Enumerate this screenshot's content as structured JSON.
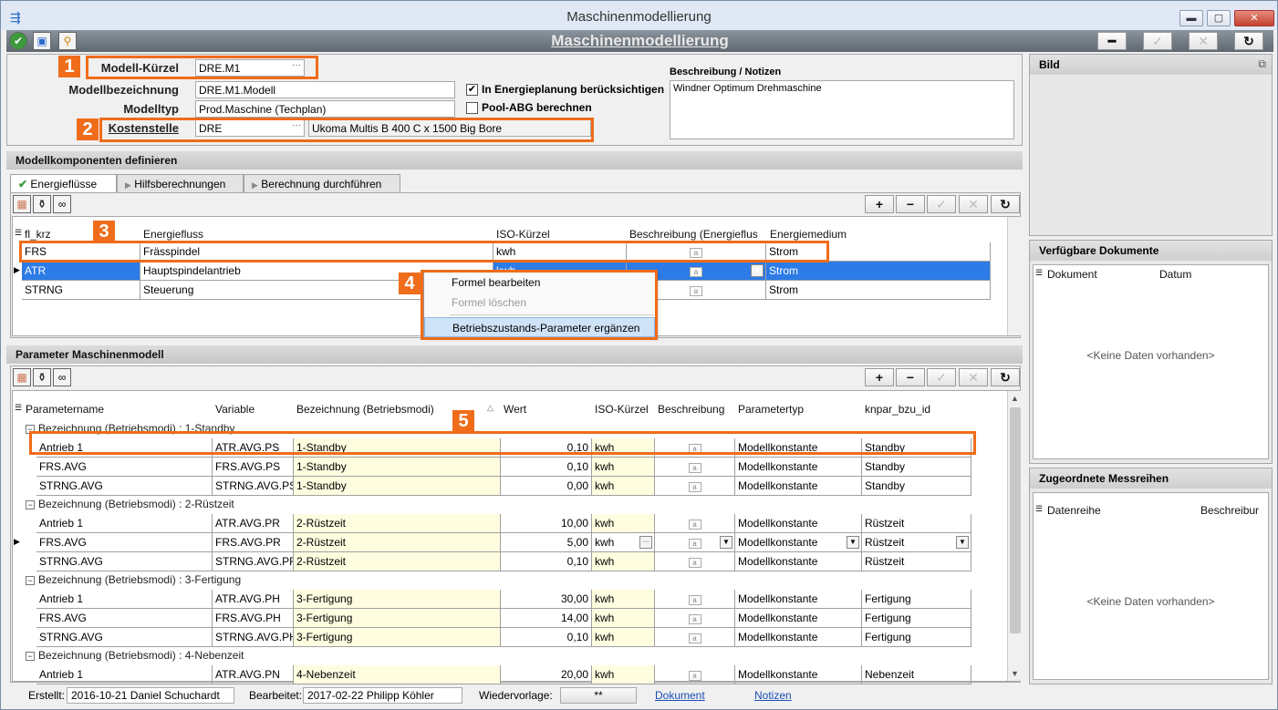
{
  "window": {
    "title": "Maschinenmodellierung"
  },
  "header": {
    "title": "Maschinenmodellierung"
  },
  "form": {
    "modell_kuerzel_label": "Modell-Kürzel",
    "modell_kuerzel": "DRE.M1",
    "modellbezeichnung_label": "Modellbezeichnung",
    "modellbezeichnung": "DRE.M1.Modell",
    "modelltyp_label": "Modelltyp",
    "modelltyp": "Prod.Maschine (Techplan)",
    "kostenstelle_label": "Kostenstelle",
    "kostenstelle": "DRE",
    "kostenstelle_name": "Ukoma Multis B 400 C x 1500 Big Bore",
    "energieplanung_label": "In Energieplanung berücksichtigen",
    "energieplanung_checked": true,
    "pool_label": "Pool-ABG berechnen",
    "pool_checked": false,
    "notes_label": "Beschreibung / Notizen",
    "notes": "Windner Optimum Drehmaschine"
  },
  "badges": [
    "1",
    "2",
    "3",
    "4",
    "5"
  ],
  "komponenten": {
    "title": "Modellkomponenten definieren",
    "tabs": [
      "Energieflüsse",
      "Hilfsberechnungen",
      "Berechnung durchführen"
    ],
    "columns": [
      "fl_krz",
      "Energiefluss",
      "ISO-Kürzel",
      "Beschreibung (Energieflus",
      "Energiemedium"
    ],
    "rows": [
      {
        "krz": "FRS",
        "fluss": "Frässpindel",
        "iso": "kwh",
        "medium": "Strom"
      },
      {
        "krz": "ATR",
        "fluss": "Hauptspindelantrieb",
        "iso": "kwh",
        "medium": "Strom"
      },
      {
        "krz": "STRNG",
        "fluss": "Steuerung",
        "iso": "",
        "medium": "Strom"
      }
    ]
  },
  "context_menu": [
    "Formel bearbeiten",
    "Formel löschen",
    "Betriebszustands-Parameter ergänzen"
  ],
  "parameter": {
    "title": "Parameter Maschinenmodell",
    "columns": [
      "Parametername",
      "Variable",
      "Bezeichnung (Betriebsmodi)",
      "Wert",
      "ISO-Kürzel",
      "Beschreibung",
      "Parametertyp",
      "knpar_bzu_id"
    ],
    "groups": [
      {
        "label": "Bezeichnung (Betriebsmodi) : 1-Standby",
        "rows": [
          {
            "name": "Antrieb 1",
            "var": "ATR.AVG.PS",
            "bez": "1-Standby",
            "wert": "0,10",
            "iso": "kwh",
            "typ": "Modellkonstante",
            "id": "Standby"
          },
          {
            "name": "FRS.AVG",
            "var": "FRS.AVG.PS",
            "bez": "1-Standby",
            "wert": "0,10",
            "iso": "kwh",
            "typ": "Modellkonstante",
            "id": "Standby"
          },
          {
            "name": "STRNG.AVG",
            "var": "STRNG.AVG.PS",
            "bez": "1-Standby",
            "wert": "0,00",
            "iso": "kwh",
            "typ": "Modellkonstante",
            "id": "Standby"
          }
        ]
      },
      {
        "label": "Bezeichnung (Betriebsmodi) : 2-Rüstzeit",
        "rows": [
          {
            "name": "Antrieb 1",
            "var": "ATR.AVG.PR",
            "bez": "2-Rüstzeit",
            "wert": "10,00",
            "iso": "kwh",
            "typ": "Modellkonstante",
            "id": "Rüstzeit"
          },
          {
            "name": "FRS.AVG",
            "var": "FRS.AVG.PR",
            "bez": "2-Rüstzeit",
            "wert": "5,00",
            "iso": "kwh",
            "typ": "Modellkonstante",
            "id": "Rüstzeit"
          },
          {
            "name": "STRNG.AVG",
            "var": "STRNG.AVG.PR",
            "bez": "2-Rüstzeit",
            "wert": "0,10",
            "iso": "kwh",
            "typ": "Modellkonstante",
            "id": "Rüstzeit"
          }
        ]
      },
      {
        "label": "Bezeichnung (Betriebsmodi) : 3-Fertigung",
        "rows": [
          {
            "name": "Antrieb 1",
            "var": "ATR.AVG.PH",
            "bez": "3-Fertigung",
            "wert": "30,00",
            "iso": "kwh",
            "typ": "Modellkonstante",
            "id": "Fertigung"
          },
          {
            "name": "FRS.AVG",
            "var": "FRS.AVG.PH",
            "bez": "3-Fertigung",
            "wert": "14,00",
            "iso": "kwh",
            "typ": "Modellkonstante",
            "id": "Fertigung"
          },
          {
            "name": "STRNG.AVG",
            "var": "STRNG.AVG.PH",
            "bez": "3-Fertigung",
            "wert": "0,10",
            "iso": "kwh",
            "typ": "Modellkonstante",
            "id": "Fertigung"
          }
        ]
      },
      {
        "label": "Bezeichnung (Betriebsmodi) : 4-Nebenzeit",
        "rows": [
          {
            "name": "Antrieb 1",
            "var": "ATR.AVG.PN",
            "bez": "4-Nebenzeit",
            "wert": "20,00",
            "iso": "kwh",
            "typ": "Modellkonstante",
            "id": "Nebenzeit"
          }
        ]
      }
    ]
  },
  "right": {
    "bild": "Bild",
    "docs_title": "Verfügbare Dokumente",
    "docs_cols": [
      "Dokument",
      "Datum"
    ],
    "docs_empty": "<Keine Daten vorhanden>",
    "mess_title": "Zugeordnete Messreihen",
    "mess_cols": [
      "Datenreihe",
      "Beschreibur"
    ],
    "mess_empty": "<Keine Daten vorhanden>"
  },
  "status": {
    "erstellt_label": "Erstellt:",
    "erstellt": "2016-10-21  Daniel Schuchardt",
    "bearbeitet_label": "Bearbeitet:",
    "bearbeitet": "2017-02-22  Philipp Köhler",
    "wiedervorlage_label": "Wiedervorlage:",
    "wiedervorlage": "**",
    "dokument": "Dokument",
    "notizen": "Notizen"
  }
}
